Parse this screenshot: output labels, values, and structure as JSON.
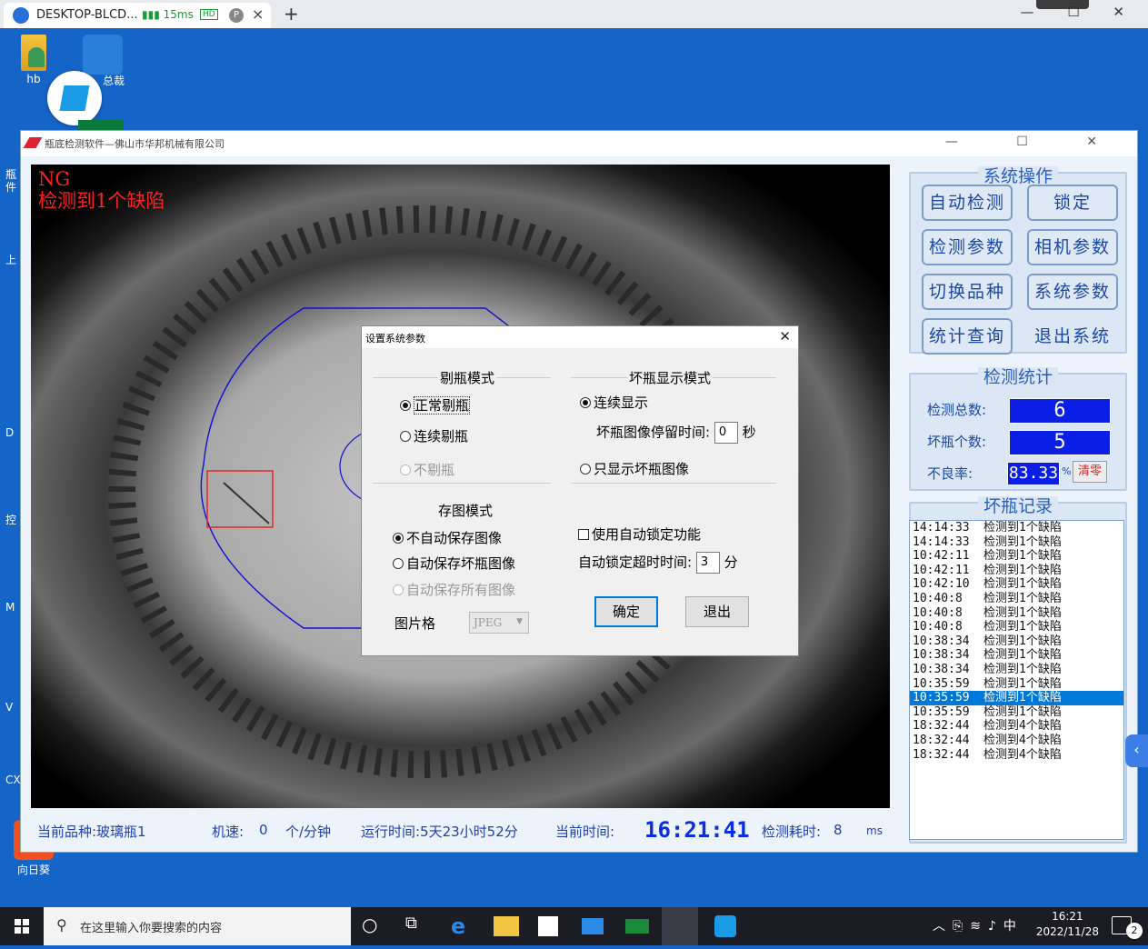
{
  "session": {
    "tab_title": "DESKTOP-BLCD...",
    "latency": "15ms",
    "hd_badge": "HD",
    "p_badge": "P",
    "close": "×",
    "new_tab": "+",
    "window_controls": "— ☐ ✕"
  },
  "desktop": {
    "icons": [
      {
        "label": "hb"
      },
      {
        "label": "总裁"
      },
      {
        "label": "向日葵"
      }
    ],
    "edge_labels": [
      "瓶",
      "件",
      "上",
      "D",
      "控",
      "M",
      "V",
      "CX"
    ]
  },
  "app": {
    "title": "瓶底检测软件—佛山市华邦机械有限公司",
    "window_controls": "— ☐ ✕",
    "ng_label": "NG",
    "defect_msg": "检测到1个缺陷"
  },
  "dialog": {
    "title": "设置系统参数",
    "close": "✕",
    "reject_mode": {
      "title": "剔瓶模式",
      "options": [
        "正常剔瓶",
        "连续剔瓶",
        "不剔瓶"
      ],
      "selected": 0
    },
    "bad_display_mode": {
      "title": "坏瓶显示模式",
      "opt_continuous": "连续显示",
      "stay_label": "坏瓶图像停留时间:",
      "stay_value": "0",
      "stay_unit": "秒",
      "opt_only_bad": "只显示坏瓶图像"
    },
    "save_mode": {
      "title": "存图模式",
      "options": [
        "不自动保存图像",
        "自动保存坏瓶图像",
        "自动保存所有图像"
      ],
      "selected": 0,
      "format_label": "图片格",
      "format_value": "JPEG"
    },
    "auto_lock": {
      "checkbox_label": "使用自动锁定功能",
      "checked": false,
      "timeout_label": "自动锁定超时时间:",
      "timeout_value": "3",
      "timeout_unit": "分"
    },
    "ok": "确定",
    "exit": "退出"
  },
  "sys_ops": {
    "title": "系统操作",
    "buttons": [
      "自动检测",
      "锁定",
      "检测参数",
      "相机参数",
      "切换品种",
      "系统参数",
      "统计查询",
      "退出系统"
    ]
  },
  "stats": {
    "title": "检测统计",
    "total_label": "检测总数:",
    "total_value": "6",
    "bad_label": "坏瓶个数:",
    "bad_value": "5",
    "rate_label": "不良率:",
    "rate_value": "83.33",
    "rate_unit": "%",
    "clear": "清零"
  },
  "records": {
    "title": "坏瓶记录",
    "rows": [
      {
        "time": "14:14:33",
        "msg": "检测到1个缺陷"
      },
      {
        "time": "14:14:33",
        "msg": "检测到1个缺陷"
      },
      {
        "time": "10:42:11",
        "msg": "检测到1个缺陷"
      },
      {
        "time": "10:42:11",
        "msg": "检测到1个缺陷"
      },
      {
        "time": "10:42:10",
        "msg": "检测到1个缺陷"
      },
      {
        "time": "10:40:8",
        "msg": "检测到1个缺陷"
      },
      {
        "time": "10:40:8",
        "msg": "检测到1个缺陷"
      },
      {
        "time": "10:40:8",
        "msg": "检测到1个缺陷"
      },
      {
        "time": "10:38:34",
        "msg": "检测到1个缺陷"
      },
      {
        "time": "10:38:34",
        "msg": "检测到1个缺陷"
      },
      {
        "time": "10:38:34",
        "msg": "检测到1个缺陷"
      },
      {
        "time": "10:35:59",
        "msg": "检测到1个缺陷"
      },
      {
        "time": "10:35:59",
        "msg": "检测到1个缺陷",
        "selected": true
      },
      {
        "time": "10:35:59",
        "msg": "检测到1个缺陷"
      },
      {
        "time": "18:32:44",
        "msg": "检测到4个缺陷"
      },
      {
        "time": "18:32:44",
        "msg": "检测到4个缺陷"
      },
      {
        "time": "18:32:44",
        "msg": "检测到4个缺陷"
      }
    ]
  },
  "status": {
    "product": "当前品种:玻璃瓶1",
    "speed_label": "机速:",
    "speed_value": "0",
    "speed_unit": "个/分钟",
    "runtime": "运行时间:5天23小时52分",
    "time_label": "当前时间:",
    "time_value": "16:21:41",
    "elapsed_label": "检测耗时:",
    "elapsed_value": "8",
    "elapsed_unit": "ms"
  },
  "taskbar": {
    "search_placeholder": "在这里输入你要搜索的内容",
    "clock_time": "16:21",
    "clock_date": "2022/11/28",
    "ime": "中",
    "notifications": "2"
  },
  "colors": {
    "desktop": "#1565c8",
    "lcd": "#0a1ee6",
    "accent_text": "#1a47a8",
    "ng_red": "#ff2020",
    "selection": "#0078d7"
  }
}
